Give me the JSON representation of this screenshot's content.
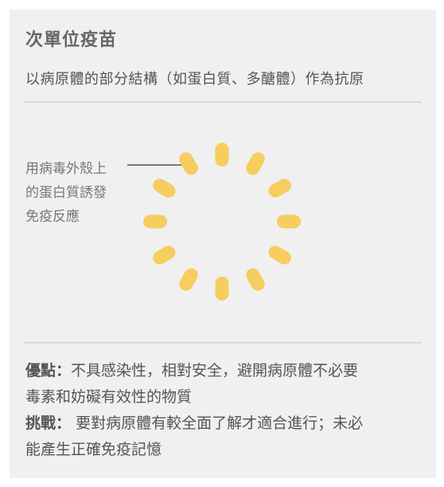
{
  "card": {
    "title": "次單位疫苗",
    "subtitle": "以病原體的部分結構（如蛋白質、多醣體）作為抗原"
  },
  "diagram": {
    "callout_lines": [
      "用病毒外殼上",
      "的蛋白質誘發",
      "免疫反應"
    ],
    "particle_color": "#f7cd5f",
    "particle_count": 12,
    "line_color": "#333333"
  },
  "info": {
    "advantages_label": "優點",
    "advantages_sep": "：",
    "advantages_line1": "不具感染性，相對安全，避開病原體不必要",
    "advantages_line2": "毒素和妨礙有效性的物質",
    "challenges_label": "挑戰",
    "challenges_sep": "：",
    "challenges_line1": " 要對病原體有較全面了解才適合進行；未必",
    "challenges_line2": "能產生正確免疫記憶"
  },
  "colors": {
    "background": "#ffffff",
    "card": "#f0f0f0",
    "divider": "#d8d8d8",
    "text": "#555555"
  }
}
